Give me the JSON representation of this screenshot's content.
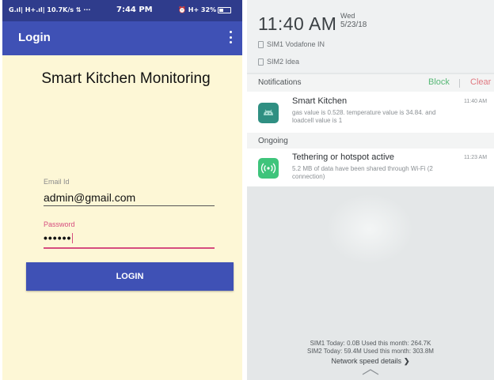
{
  "left_screen": {
    "status_bar": {
      "left": "G.ıl| H+.ıl| 10.7K/s ⇅ ···",
      "time": "7:44 PM",
      "right": "⏰ H+ 32%"
    },
    "app_bar": {
      "title": "Login"
    },
    "heading": "Smart Kitchen Monitoring",
    "email": {
      "label": "Email Id",
      "value": "admin@gmail.com"
    },
    "password": {
      "label": "Password",
      "value": "••••••"
    },
    "login_button": "LOGIN",
    "colors": {
      "primary": "#3f51b5",
      "background": "#fdf7d6",
      "accent": "#d64d7f"
    }
  },
  "right_screen": {
    "clock": {
      "time": "11:40 AM",
      "day": "Wed",
      "date": "5/23/18"
    },
    "sims": [
      "SIM1 Vodafone IN",
      "SIM2 Idea"
    ],
    "notifications_header": {
      "title": "Notifications",
      "block": "Block",
      "clear": "Clear"
    },
    "notifications": [
      {
        "icon": "android-icon",
        "title": "Smart Kitchen",
        "time": "11:40 AM",
        "body_line1": "gas value is 0.528. temperature value is 34.84. and",
        "body_line2": "loadcell value is 1"
      }
    ],
    "ongoing_label": "Ongoing",
    "ongoing": [
      {
        "icon": "hotspot-icon",
        "title": "Tethering or hotspot active",
        "time": "11:23 AM",
        "body_line1": "5.2 MB of data have been shared through Wi-Fi (2",
        "body_line2": "connection)"
      }
    ],
    "data_usage": {
      "sim1": "SIM1 Today: 0.0B   Used this month: 264.7K",
      "sim2": "SIM2 Today: 59.4M   Used this month: 303.8M"
    },
    "network_speed": "Network speed details",
    "colors": {
      "block": "#58b877",
      "clear": "#e07880"
    }
  }
}
